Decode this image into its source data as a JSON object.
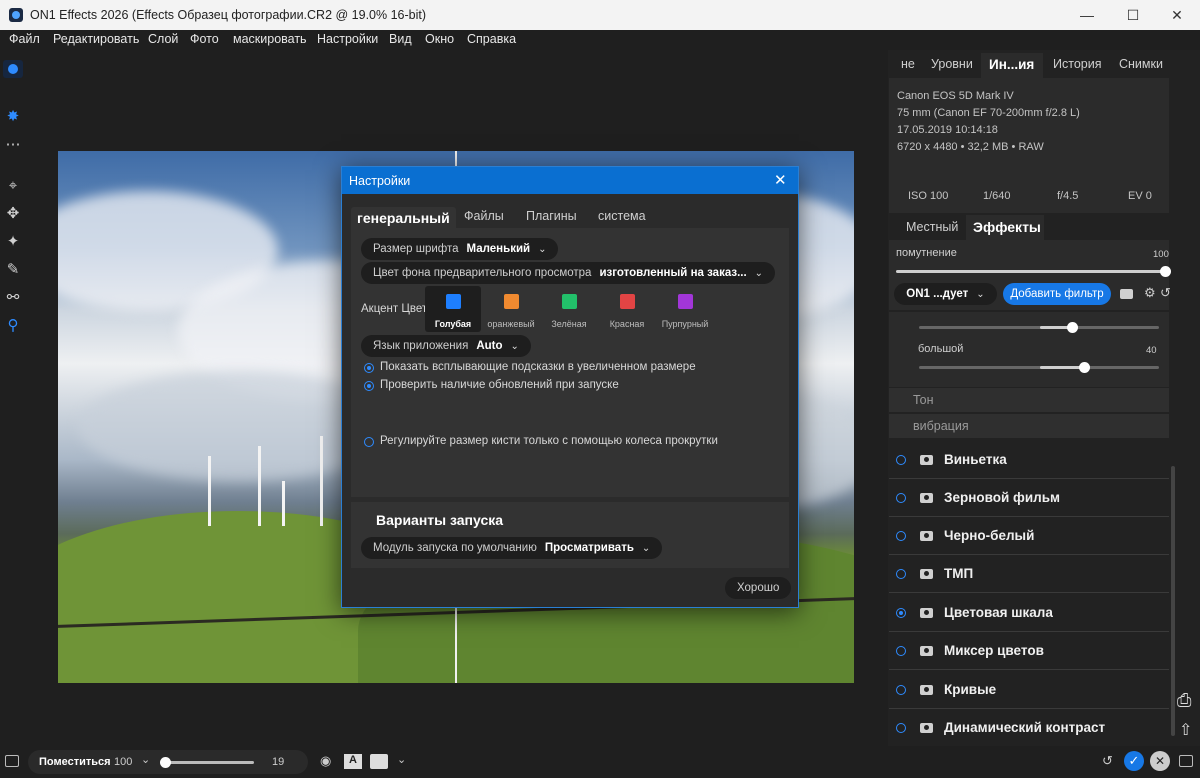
{
  "window": {
    "title": "ON1 Effects 2026 (Effects Образец фотографии.CR2 @ 19.0% 16-bit)"
  },
  "menu": [
    "Файл",
    "Редактировать",
    "Слой",
    "Фото",
    "маскировать",
    "Настройки",
    "Вид",
    "Окно",
    "Справка"
  ],
  "dialog": {
    "title": "Настройки",
    "tabs": [
      "генеральный",
      "Файлы",
      "Плагины",
      "система"
    ],
    "font_size_label": "Размер шрифта",
    "font_size_value": "Маленький",
    "preview_bg_label": "Цвет фона предварительного просмотра",
    "preview_bg_value": "изготовленный на заказ...",
    "accent_label": "Акцент Цвет",
    "accents": [
      {
        "label": "Голубая",
        "color": "#1e7fff",
        "selected": true
      },
      {
        "label": "оранжевый",
        "color": "#f08a30"
      },
      {
        "label": "Зелёная",
        "color": "#22c06a"
      },
      {
        "label": "Красная",
        "color": "#e24444"
      },
      {
        "label": "Пурпурный",
        "color": "#a236d8"
      }
    ],
    "language_label": "Язык приложения",
    "language_value": "Auto",
    "options": {
      "tooltips": "Показать всплывающие подсказки в увеличенном размере",
      "updates": "Проверить наличие обновлений при запуске",
      "brush": "Регулируйте размер кисти только с помощью колеса прокрутки"
    },
    "launch_title": "Варианты запуска",
    "launch_label": "Модуль запуска по умолчанию",
    "launch_value": "Просматривать",
    "ok": "Хорошо"
  },
  "right": {
    "tabs": [
      "не",
      "Уровни",
      "Ин...ия",
      "История",
      "Снимки"
    ],
    "camera": "Canon EOS 5D Mark IV",
    "lens": "75 mm (Canon EF 70-200mm f/2.8 L)",
    "date": "17.05.2019 10:14:18",
    "dims": "6720 x 4480 • 32,2 MB • RAW",
    "iso": "ISO 100",
    "shutter": "1/640",
    "aperture": "f/4.5",
    "ev": "EV 0",
    "sub_tabs": [
      "Местный",
      "Эффекты"
    ],
    "opacity_label": "помутнение",
    "opacity_value": "100",
    "preset": "ON1 ...дует",
    "add_filter": "Добавить фильтр",
    "large_label": "большой",
    "large_value": "40",
    "collapsed": [
      "Тон",
      "вибрация"
    ],
    "filters": [
      "Виньетка",
      "Зерновой фильм",
      "Черно-белый",
      "ТМП",
      "Цветовая шкала",
      "Миксер цветов",
      "Кривые",
      "Динамический контраст"
    ]
  },
  "bottom": {
    "fit": "Поместиться",
    "zoom": "100",
    "brush": "19"
  }
}
